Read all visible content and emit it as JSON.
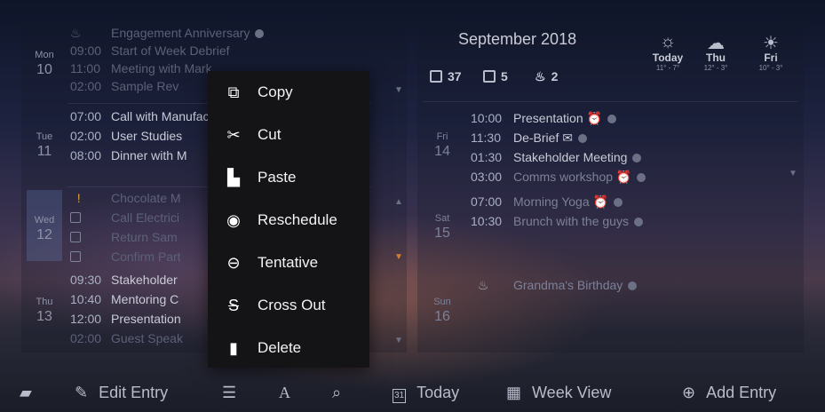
{
  "left_agenda": {
    "days": [
      {
        "name": "Mon",
        "date": "10"
      },
      {
        "name": "Tue",
        "date": "11"
      },
      {
        "name": "Wed",
        "date": "12"
      },
      {
        "name": "Thu",
        "date": "13"
      }
    ],
    "events": [
      {
        "time": "",
        "title": "Engagement Anniversary",
        "dim": true
      },
      {
        "time": "09:00",
        "title": "Start of Week Debrief",
        "dim": true
      },
      {
        "time": "11:00",
        "title": "Meeting with Mark",
        "dim": true
      },
      {
        "time": "02:00",
        "title": "Sample Rev",
        "dim": true
      },
      {
        "time": "07:00",
        "title": "Call with Manufacturers",
        "dim": false
      },
      {
        "time": "02:00",
        "title": "User Studies",
        "dim": false
      },
      {
        "time": "08:00",
        "title": "Dinner with M",
        "dim": false
      },
      {
        "time": "",
        "title": "Chocolate M",
        "dim": true
      },
      {
        "time": "",
        "title": "Call Electrici",
        "dim": true
      },
      {
        "time": "",
        "title": "Return Sam",
        "dim": true
      },
      {
        "time": "",
        "title": "Confirm Part",
        "dim": true
      },
      {
        "time": "09:30",
        "title": "Stakeholder",
        "dim": false
      },
      {
        "time": "10:40",
        "title": "Mentoring C",
        "dim": false
      },
      {
        "time": "12:00",
        "title": "Presentation",
        "dim": false
      },
      {
        "time": "02:00",
        "title": "Guest Speak",
        "dim": true
      }
    ]
  },
  "right_panel": {
    "month": "September 2018",
    "stats": [
      {
        "icon": "calendar-icon",
        "value": "37"
      },
      {
        "icon": "checkbox-icon",
        "value": "5"
      },
      {
        "icon": "birthday-cake-icon",
        "value": "2"
      }
    ],
    "weather": [
      {
        "icon": "partly-cloudy-icon",
        "day": "Today",
        "temp": "11° - 7°"
      },
      {
        "icon": "rain-cloud-icon",
        "day": "Thu",
        "temp": "12° - 3°"
      },
      {
        "icon": "sun-icon",
        "day": "Fri",
        "temp": "10° - 3°"
      }
    ],
    "days": [
      {
        "name": "Fri",
        "date": "14"
      },
      {
        "name": "Sat",
        "date": "15"
      },
      {
        "name": "Sun",
        "date": "16"
      }
    ],
    "events": [
      {
        "time": "10:00",
        "title": "Presentation"
      },
      {
        "time": "11:30",
        "title": "De-Brief"
      },
      {
        "time": "01:30",
        "title": "Stakeholder Meeting"
      },
      {
        "time": "03:00",
        "title": "Comms workshop"
      },
      {
        "time": "07:00",
        "title": "Morning Yoga"
      },
      {
        "time": "10:30",
        "title": "Brunch with the guys"
      },
      {
        "time": "",
        "title": "Grandma's Birthday"
      }
    ]
  },
  "context_menu": {
    "items": [
      {
        "icon": "copy-icon",
        "label": "Copy"
      },
      {
        "icon": "scissors-icon",
        "label": "Cut"
      },
      {
        "icon": "paste-icon",
        "label": "Paste"
      },
      {
        "icon": "reschedule-icon",
        "label": "Reschedule"
      },
      {
        "icon": "tentative-icon",
        "label": "Tentative"
      },
      {
        "icon": "strikethrough-icon",
        "label": "Cross Out"
      },
      {
        "icon": "trash-icon",
        "label": "Delete"
      }
    ]
  },
  "toolbar": {
    "edit_label": "Edit Entry",
    "today_label": "Today",
    "week_view_label": "Week View",
    "add_label": "Add Entry",
    "today_icon_text": "31"
  }
}
